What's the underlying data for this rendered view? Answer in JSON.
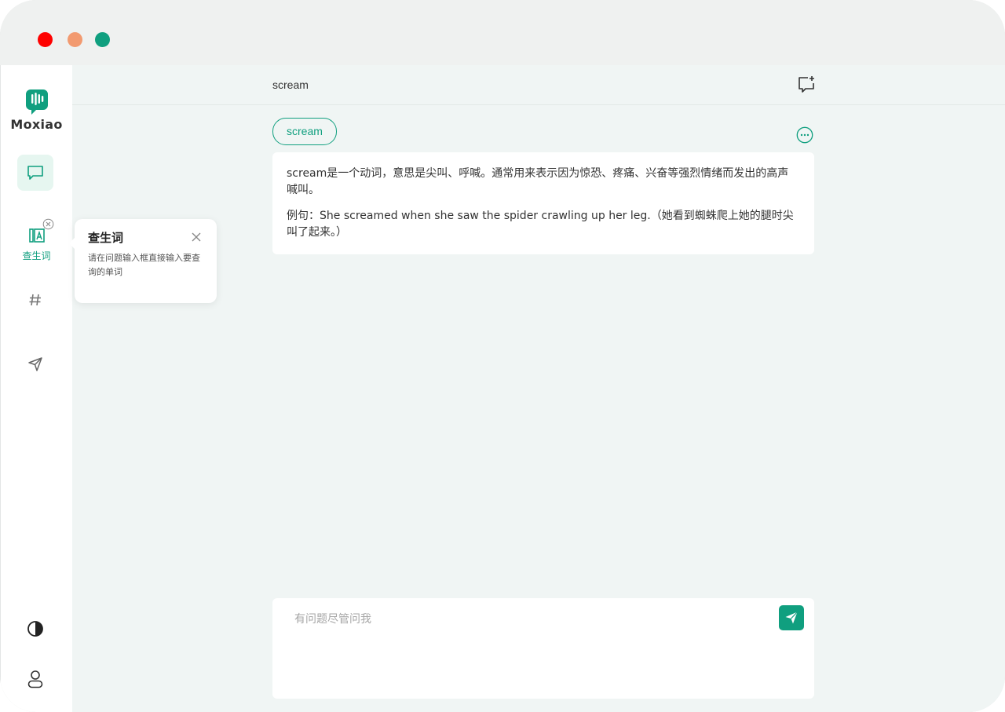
{
  "app": {
    "name": "Moxiao"
  },
  "sidebar": {
    "vocab_label": "查生词"
  },
  "header": {
    "title": "scream"
  },
  "conversation": {
    "query": "scream",
    "answer_definition": "scream是一个动词，意思是尖叫、呼喊。通常用来表示因为惊恐、疼痛、兴奋等强烈情绪而发出的高声喊叫。",
    "answer_example": "例句：She screamed when she saw the spider crawling up her leg.（她看到蜘蛛爬上她的腿时尖叫了起来。）"
  },
  "tooltip": {
    "title": "查生词",
    "description": "请在问题输入框直接输入要查询的单词"
  },
  "input": {
    "placeholder": "有问题尽管问我",
    "value": ""
  },
  "colors": {
    "accent": "#109f7f",
    "background": "#f0f5f4"
  }
}
